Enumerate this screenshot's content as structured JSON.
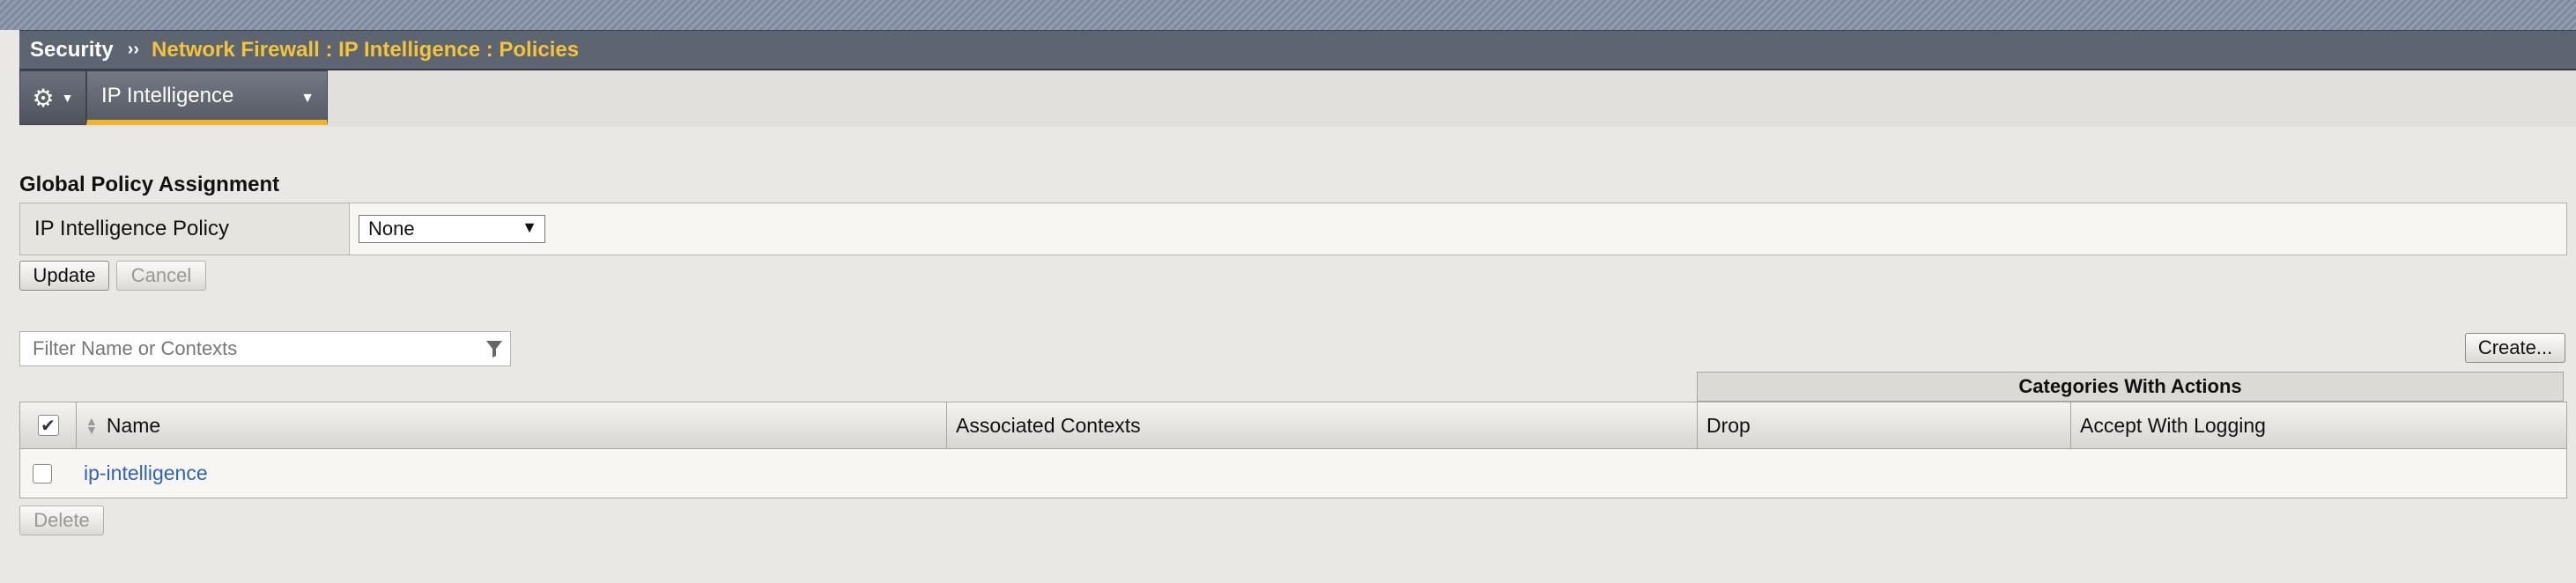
{
  "breadcrumb": {
    "root": "Security",
    "separator": "››",
    "path": "Network Firewall : IP Intelligence : Policies"
  },
  "tabs": {
    "active_label": "IP Intelligence"
  },
  "global_policy": {
    "section_title": "Global Policy Assignment",
    "label": "IP Intelligence Policy",
    "selected_value": "None"
  },
  "buttons": {
    "update": "Update",
    "cancel": "Cancel",
    "create": "Create...",
    "delete": "Delete"
  },
  "filter": {
    "placeholder": "Filter Name or Contexts"
  },
  "table": {
    "group_header": "Categories With Actions",
    "columns": [
      "Name",
      "Associated Contexts",
      "Drop",
      "Accept With Logging"
    ],
    "rows": [
      {
        "name": "ip-intelligence"
      }
    ]
  },
  "icons": {
    "gear": "gear-icon",
    "dropdown": "chevron-down-icon",
    "filter": "filter-icon",
    "sort": "sort-icon"
  },
  "colors": {
    "breadcrumb_bg": "#5d6472",
    "breadcrumb_path": "#f3c33a",
    "tab_accent": "#f0b429",
    "link": "#2f64b5"
  }
}
